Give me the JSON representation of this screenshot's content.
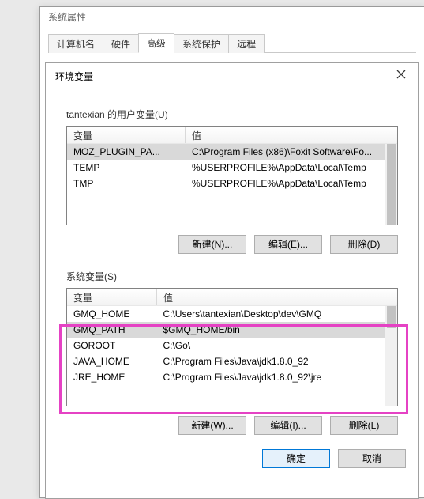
{
  "outer": {
    "title": "系统属性"
  },
  "tabs": {
    "t0": "计算机名",
    "t1": "硬件",
    "t2": "高级",
    "t3": "系统保护",
    "t4": "远程"
  },
  "inner": {
    "title": "环境变量"
  },
  "user_section": {
    "label": "tantexian 的用户变量(U)",
    "header_var": "变量",
    "header_val": "值",
    "rows": [
      {
        "var": "MOZ_PLUGIN_PA...",
        "val": "C:\\Program Files (x86)\\Foxit Software\\Fo...",
        "selected": true
      },
      {
        "var": "TEMP",
        "val": "%USERPROFILE%\\AppData\\Local\\Temp"
      },
      {
        "var": "TMP",
        "val": "%USERPROFILE%\\AppData\\Local\\Temp"
      }
    ],
    "buttons": {
      "new": "新建(N)...",
      "edit": "编辑(E)...",
      "delete": "删除(D)"
    }
  },
  "sys_section": {
    "label": "系统变量(S)",
    "header_var": "变量",
    "header_val": "值",
    "rows": [
      {
        "var": "GMQ_HOME",
        "val": "C:\\Users\\tantexian\\Desktop\\dev\\GMQ"
      },
      {
        "var": "GMQ_PATH",
        "val": "$GMQ_HOME/bin",
        "selected": true
      },
      {
        "var": "GOROOT",
        "val": "C:\\Go\\"
      },
      {
        "var": "JAVA_HOME",
        "val": "C:\\Program Files\\Java\\jdk1.8.0_92"
      },
      {
        "var": "JRE_HOME",
        "val": "C:\\Program Files\\Java\\jdk1.8.0_92\\jre"
      }
    ],
    "buttons": {
      "new": "新建(W)...",
      "edit": "编辑(I)...",
      "delete": "删除(L)"
    }
  },
  "footer": {
    "ok": "确定",
    "cancel": "取消"
  }
}
